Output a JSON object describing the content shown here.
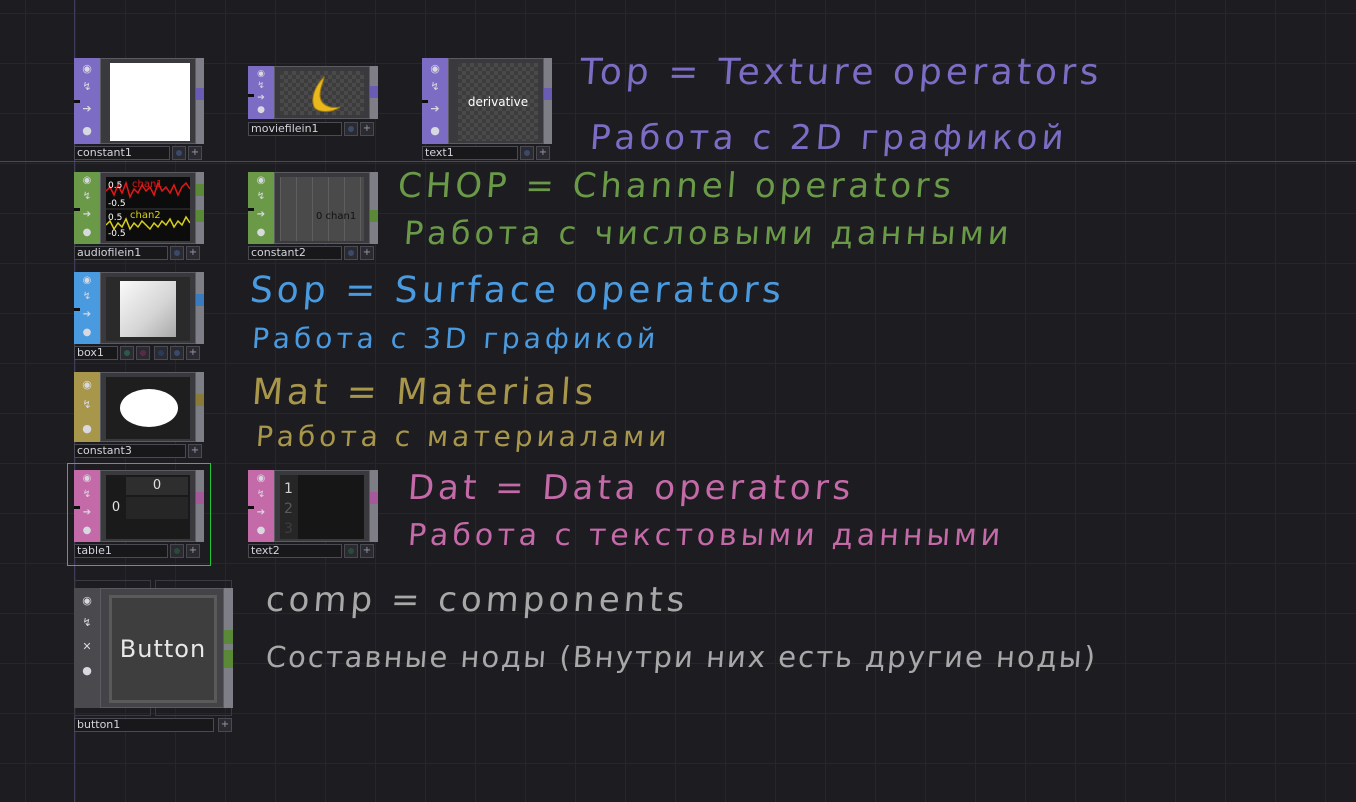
{
  "nodes": {
    "constant1": {
      "name": "constant1"
    },
    "moviefilein1": {
      "name": "moviefilein1"
    },
    "text1": {
      "name": "text1",
      "view_text": "derivative"
    },
    "audiofilein1": {
      "name": "audiofilein1",
      "chan1": "chan1",
      "chan2": "chan2",
      "tick_top1": "0.5",
      "tick_bot1": "-0.5",
      "tick_top2": "0.5",
      "tick_bot2": "-0.5"
    },
    "constant2": {
      "name": "constant2",
      "view_text": "0 chan1"
    },
    "box1": {
      "name": "box1"
    },
    "constant3": {
      "name": "constant3"
    },
    "table1": {
      "name": "table1",
      "cell_header": "0",
      "cell_row": "0"
    },
    "text2": {
      "name": "text2",
      "lines": [
        "1",
        "2",
        "3"
      ]
    },
    "button1": {
      "name": "button1",
      "view_text": "Button"
    }
  },
  "notes": {
    "top_line1": "Top = Texture operators",
    "top_line2": "Работа с 2D графикой",
    "chop_line1": "CHOP = Channel operators",
    "chop_line2": "Работа с числовыми данными",
    "sop_line1": "Sop = Surface operators",
    "sop_line2": "Работа с 3D графикой",
    "mat_line1": "Mat = Materials",
    "mat_line2": "Работа с материалами",
    "dat_line1": "Dat = Data operators",
    "dat_line2": "Работа с текстовыми данными",
    "comp_line1": "comp = components",
    "comp_line2": "Составные ноды (Внутри них есть другие ноды)"
  },
  "colors": {
    "top": "#7c6cc4",
    "chop": "#6a9a48",
    "sop": "#4a9ae0",
    "mat": "#a8974a",
    "dat": "#c46aa8",
    "comp": "#a8a8a8",
    "selected": "#22c832"
  },
  "icons": [
    "viewer-toggle-icon",
    "cook-icon",
    "bypass-arrow-icon",
    "lock-icon",
    "close-icon"
  ]
}
